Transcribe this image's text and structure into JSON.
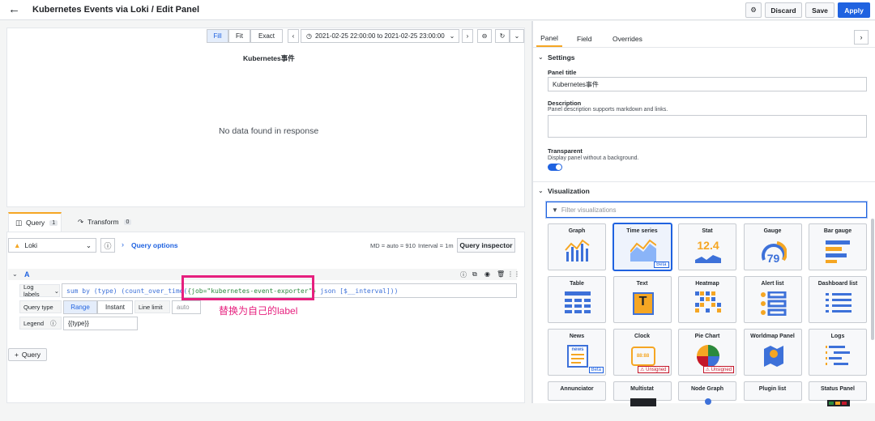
{
  "header": {
    "title": "Kubernetes Events via Loki / Edit Panel",
    "discard": "Discard",
    "save": "Save",
    "apply": "Apply"
  },
  "timebar": {
    "fill": "Fill",
    "fit": "Fit",
    "exact": "Exact",
    "range": "2021-02-25 22:00:00 to 2021-02-25 23:00:00"
  },
  "panel": {
    "title": "Kubernetes事件",
    "nodata": "No data found in response"
  },
  "query_tabs": [
    {
      "label": "Query",
      "count": "1"
    },
    {
      "label": "Transform",
      "count": "0"
    }
  ],
  "datasource": {
    "name": "Loki",
    "query_options": "Query options",
    "md": "MD = auto = 910",
    "interval": "Interval = 1m",
    "inspector": "Query inspector"
  },
  "query": {
    "ref": "A",
    "log_labels": "Log labels",
    "code_pre": "sum by (type) (count_over_time(",
    "code_hl": "{job=\"kubernetes-event-exporter\"}",
    "code_post": " json [$__interval]))",
    "query_type": "Query type",
    "range": "Range",
    "instant": "Instant",
    "line_limit": "Line limit",
    "line_limit_ph": "auto",
    "legend": "Legend",
    "legend_value": "{{type}}",
    "add": "Query"
  },
  "annotation": "替换为自己的label",
  "right_tabs": [
    "Panel",
    "Field",
    "Overrides"
  ],
  "settings": {
    "head": "Settings",
    "title_label": "Panel title",
    "title_value": "Kubernetes事件",
    "desc_label": "Description",
    "desc_help": "Panel description supports markdown and links.",
    "transparent_label": "Transparent",
    "transparent_help": "Display panel without a background."
  },
  "visualization": {
    "head": "Visualization",
    "filter_ph": "Filter visualizations",
    "tiles": [
      {
        "name": "Graph"
      },
      {
        "name": "Time series",
        "badge": "Beta"
      },
      {
        "name": "Stat",
        "big": "12.4"
      },
      {
        "name": "Gauge",
        "big": "79"
      },
      {
        "name": "Bar gauge"
      },
      {
        "name": "Table"
      },
      {
        "name": "Text",
        "big": "T"
      },
      {
        "name": "Heatmap"
      },
      {
        "name": "Alert list"
      },
      {
        "name": "Dashboard list"
      },
      {
        "name": "News",
        "badge": "Beta",
        "sub": "news"
      },
      {
        "name": "Clock",
        "badge2": "Unsigned",
        "sub": "88:88"
      },
      {
        "name": "Pie Chart",
        "badge2": "Unsigned"
      },
      {
        "name": "Worldmap Panel"
      },
      {
        "name": "Logs"
      },
      {
        "name": "Annunciator"
      },
      {
        "name": "Multistat"
      },
      {
        "name": "Node Graph"
      },
      {
        "name": "Plugin list"
      },
      {
        "name": "Status Panel"
      }
    ]
  }
}
